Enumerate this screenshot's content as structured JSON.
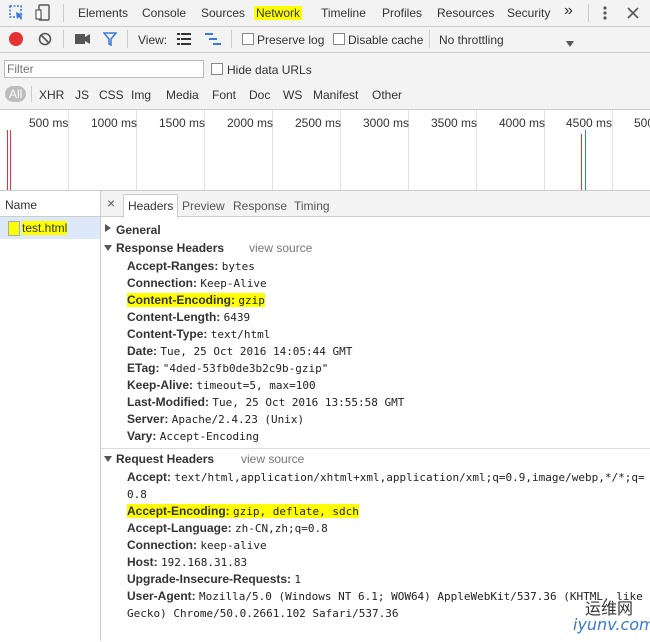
{
  "main_tabs": [
    "Elements",
    "Console",
    "Sources",
    "Network",
    "Timeline",
    "Profiles",
    "Resources",
    "Security"
  ],
  "more_tabs_glyph": "»",
  "toolbar": {
    "view_label": "View:",
    "preserve_log": "Preserve log",
    "disable_cache": "Disable cache",
    "throttling": "No throttling"
  },
  "filter": {
    "placeholder": "Filter",
    "hide_data_urls": "Hide data URLs",
    "types": [
      "All",
      "XHR",
      "JS",
      "CSS",
      "Img",
      "Media",
      "Font",
      "Doc",
      "WS",
      "Manifest",
      "Other"
    ]
  },
  "timeline": {
    "ticks": [
      "500 ms",
      "1000 ms",
      "1500 ms",
      "2000 ms",
      "2500 ms",
      "3000 ms",
      "3500 ms",
      "4000 ms",
      "4500 ms",
      "500"
    ]
  },
  "requests": {
    "column_name": "Name",
    "items": [
      "test.html"
    ]
  },
  "details": {
    "close_glyph": "×",
    "tabs": [
      "Headers",
      "Preview",
      "Response",
      "Timing"
    ],
    "general": "General",
    "response_headers_title": "Response Headers",
    "request_headers_title": "Request Headers",
    "view_source": "view source",
    "response_headers": [
      {
        "name": "Accept-Ranges:",
        "value": "bytes"
      },
      {
        "name": "Connection:",
        "value": "Keep-Alive"
      },
      {
        "name": "Content-Encoding:",
        "value": "gzip"
      },
      {
        "name": "Content-Length:",
        "value": "6439"
      },
      {
        "name": "Content-Type:",
        "value": "text/html"
      },
      {
        "name": "Date:",
        "value": "Tue, 25 Oct 2016 14:05:44 GMT"
      },
      {
        "name": "ETag:",
        "value": "\"4ded-53fb0de3b2c9b-gzip\""
      },
      {
        "name": "Keep-Alive:",
        "value": "timeout=5, max=100"
      },
      {
        "name": "Last-Modified:",
        "value": "Tue, 25 Oct 2016 13:55:58 GMT"
      },
      {
        "name": "Server:",
        "value": "Apache/2.4.23 (Unix)"
      },
      {
        "name": "Vary:",
        "value": "Accept-Encoding"
      }
    ],
    "request_headers": [
      {
        "name": "Accept:",
        "value": "text/html,application/xhtml+xml,application/xml;q=0.9,image/webp,*/*;q="
      },
      {
        "name": "",
        "value": "0.8"
      },
      {
        "name": "Accept-Encoding:",
        "value": "gzip, deflate, sdch"
      },
      {
        "name": "Accept-Language:",
        "value": "zh-CN,zh;q=0.8"
      },
      {
        "name": "Connection:",
        "value": "keep-alive"
      },
      {
        "name": "Host:",
        "value": "192.168.31.83"
      },
      {
        "name": "Upgrade-Insecure-Requests:",
        "value": "1"
      },
      {
        "name": "User-Agent:",
        "value": "Mozilla/5.0 (Windows NT 6.1; WOW64) AppleWebKit/537.36 (KHTML, like"
      },
      {
        "name": "",
        "value": "Gecko) Chrome/50.0.2661.102 Safari/537.36"
      }
    ]
  },
  "watermark": {
    "line1": "运维网",
    "line2": "iyunv.com"
  },
  "colors": {
    "highlight": "#ffff00",
    "record": "#e5312f",
    "accent": "#3879d9"
  }
}
